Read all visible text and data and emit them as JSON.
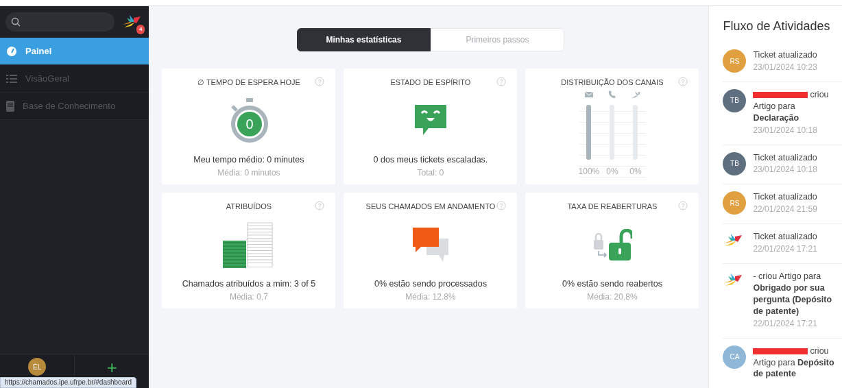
{
  "sidebar": {
    "logo_badge": "4",
    "items": [
      {
        "label": "Painel",
        "selected": true
      },
      {
        "label": "VisãoGeral",
        "selected": false
      },
      {
        "label": "Base de Conhecimento",
        "selected": false
      }
    ],
    "user_avatar": {
      "initials": "ÉL"
    },
    "add_button": "+"
  },
  "status_url": "https://chamados.ipe.ufrpe.br/#dashboard",
  "tabs": [
    {
      "label": "Minhas estatísticas",
      "selected": true
    },
    {
      "label": "Primeiros passos",
      "selected": false
    }
  ],
  "cards": [
    {
      "kind": "stopwatch",
      "title": "∅ TEMPO DE ESPERA HOJE",
      "value": "0",
      "main": "Meu tempo médio: 0 minutes",
      "sub": "Média: 0 minutos"
    },
    {
      "kind": "mood",
      "title": "ESTADO DE ESPÍRITO",
      "main": "0 dos meus tickets escaladas.",
      "sub": "Total: 0"
    },
    {
      "kind": "channels",
      "title": "DISTRIBUIÇÃO DOS CANAIS",
      "channels": [
        {
          "level": 1,
          "reading": "100%"
        },
        {
          "level": 0,
          "reading": "0%"
        },
        {
          "level": 0,
          "reading": "0%"
        }
      ]
    },
    {
      "kind": "stack",
      "title": "ATRIBUÍDOS",
      "main": "Chamados atribuídos a mim: 3 of 5",
      "sub": "Média: 0.7"
    },
    {
      "kind": "chat",
      "title": "SEUS CHAMADOS EM ANDAMENTO",
      "main": "0% estão sendo processados",
      "sub": "Média: 12.8%"
    },
    {
      "kind": "lock",
      "title": "TAXA DE REABERTURAS",
      "main": "0% estão sendo reabertos",
      "sub": "Média: 20.8%"
    }
  ],
  "activity": {
    "title": "Fluxo de Atividades",
    "items": [
      {
        "kind": "initials",
        "initials": "RS",
        "color": "#e0a040",
        "redacted": false,
        "text": "Ticket atualizado",
        "time": "23/01/2024 10:23"
      },
      {
        "kind": "initials",
        "initials": "TB",
        "color": "#5f6f80",
        "redacted": true,
        "text": "criou Artigo para **Declaração**",
        "time": "23/01/2024 10:18"
      },
      {
        "kind": "initials",
        "initials": "TB",
        "color": "#5f6f80",
        "redacted": false,
        "text": "Ticket atualizado",
        "time": "23/01/2024 10:18"
      },
      {
        "kind": "initials",
        "initials": "RS",
        "color": "#e0a040",
        "redacted": false,
        "text": "Ticket atualizado",
        "time": "22/01/2024 21:59"
      },
      {
        "kind": "logo",
        "redacted": false,
        "text": "Ticket atualizado",
        "time": "22/01/2024 17:21"
      },
      {
        "kind": "logo",
        "redacted": false,
        "text": "- criou Artigo para **Obrigado por sua pergunta (Depósito de patente)**",
        "time": "22/01/2024 17:21"
      },
      {
        "kind": "initials",
        "initials": "CA",
        "color": "#8fb8d8",
        "redacted": true,
        "text": "criou Artigo para **Depósito de patente**"
      }
    ]
  }
}
